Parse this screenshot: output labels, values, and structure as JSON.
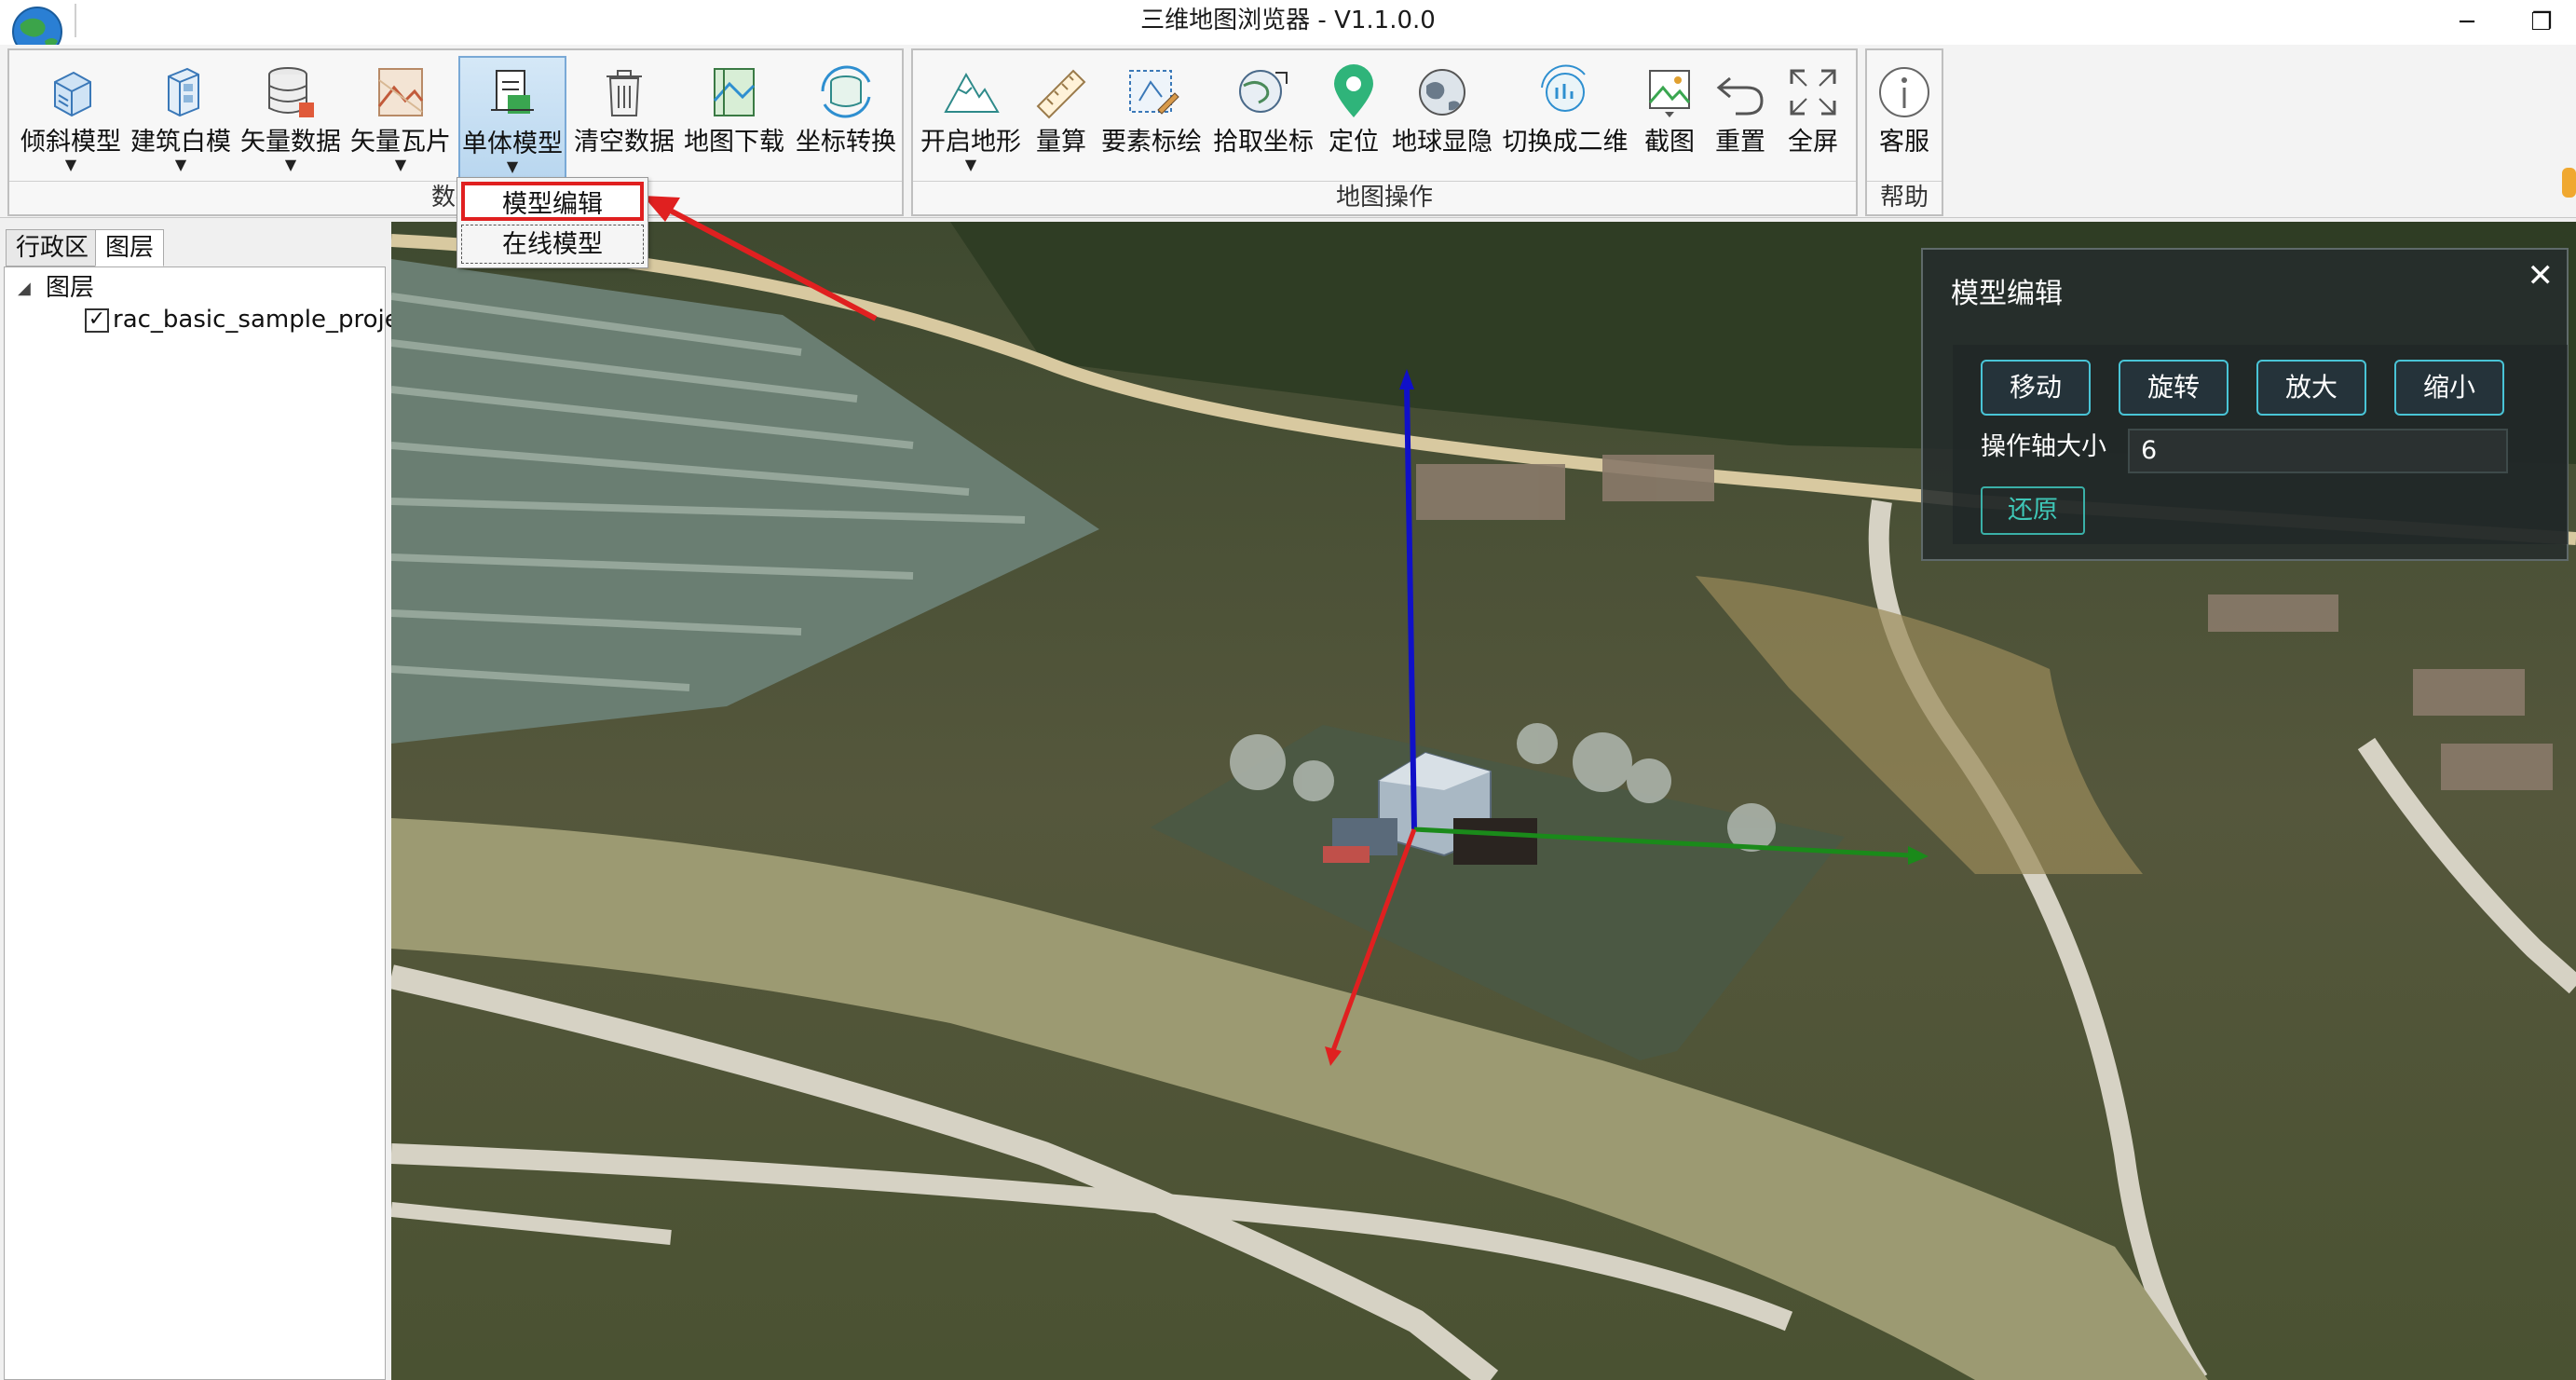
{
  "window": {
    "title": "三维地图浏览器 - V1.1.0.0",
    "minimize": "─",
    "restore": "❐"
  },
  "ribbon": {
    "data_group": {
      "label": "数据",
      "buttons": [
        {
          "label": "倾斜模型",
          "icon": "oblique-model-icon"
        },
        {
          "label": "建筑白模",
          "icon": "building-white-model-icon"
        },
        {
          "label": "矢量数据",
          "icon": "vector-data-icon"
        },
        {
          "label": "矢量瓦片",
          "icon": "vector-tile-icon"
        },
        {
          "label": "单体模型",
          "icon": "single-model-icon"
        },
        {
          "label": "清空数据",
          "icon": "trash-icon"
        },
        {
          "label": "地图下载",
          "icon": "map-download-icon"
        },
        {
          "label": "坐标转换",
          "icon": "coordinate-convert-icon"
        }
      ]
    },
    "map_group": {
      "label": "地图操作",
      "buttons": [
        {
          "label": "开启地形",
          "icon": "terrain-icon"
        },
        {
          "label": "量算",
          "icon": "ruler-icon"
        },
        {
          "label": "要素标绘",
          "icon": "feature-plot-icon"
        },
        {
          "label": "拾取坐标",
          "icon": "pick-coordinate-icon"
        },
        {
          "label": "定位",
          "icon": "location-pin-icon"
        },
        {
          "label": "地球显隐",
          "icon": "globe-icon"
        },
        {
          "label": "切换成二维",
          "icon": "switch-2d-icon"
        },
        {
          "label": "截图",
          "icon": "screenshot-icon"
        },
        {
          "label": "重置",
          "icon": "reset-icon"
        },
        {
          "label": "全屏",
          "icon": "fullscreen-icon"
        }
      ]
    },
    "help_group": {
      "label": "帮助",
      "buttons": [
        {
          "label": "客服",
          "icon": "info-icon"
        }
      ]
    }
  },
  "dropdown": {
    "items": [
      "模型编辑",
      "在线模型"
    ]
  },
  "left_panel": {
    "tabs": [
      "行政区",
      "图层"
    ],
    "tree": {
      "toggle": "◢",
      "root": "图层",
      "children": [
        {
          "label": "rac_basic_sample_project",
          "checked": true
        }
      ]
    }
  },
  "editor": {
    "title": "模型编辑",
    "close": "✕",
    "buttons": [
      "移动",
      "旋转",
      "放大",
      "缩小"
    ],
    "axis_label": "操作轴大小",
    "axis_value": "6",
    "reset": "还原"
  },
  "colors": {
    "accent": "#49c4d6",
    "reset_text": "#3ec7b7",
    "highlight_red": "#e02020",
    "axis_x": "#e02020",
    "axis_y": "#1a8a1a",
    "axis_z": "#1010c8"
  }
}
